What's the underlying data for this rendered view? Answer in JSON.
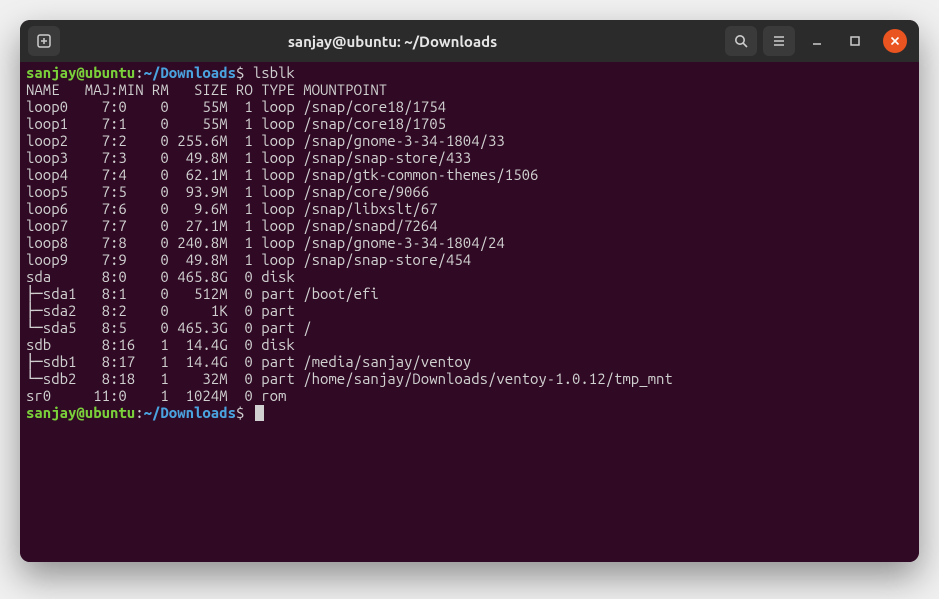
{
  "window": {
    "title": "sanjay@ubuntu: ~/Downloads"
  },
  "prompt": {
    "user_host": "sanjay@ubuntu",
    "path": "~/Downloads",
    "command": "lsblk"
  },
  "lsblk": {
    "header": "NAME   MAJ:MIN RM   SIZE RO TYPE MOUNTPOINT",
    "rows": [
      "loop0    7:0    0    55M  1 loop /snap/core18/1754",
      "loop1    7:1    0    55M  1 loop /snap/core18/1705",
      "loop2    7:2    0 255.6M  1 loop /snap/gnome-3-34-1804/33",
      "loop3    7:3    0  49.8M  1 loop /snap/snap-store/433",
      "loop4    7:4    0  62.1M  1 loop /snap/gtk-common-themes/1506",
      "loop5    7:5    0  93.9M  1 loop /snap/core/9066",
      "loop6    7:6    0   9.6M  1 loop /snap/libxslt/67",
      "loop7    7:7    0  27.1M  1 loop /snap/snapd/7264",
      "loop8    7:8    0 240.8M  1 loop /snap/gnome-3-34-1804/24",
      "loop9    7:9    0  49.8M  1 loop /snap/snap-store/454",
      "sda      8:0    0 465.8G  0 disk ",
      "├─sda1   8:1    0   512M  0 part /boot/efi",
      "├─sda2   8:2    0     1K  0 part ",
      "└─sda5   8:5    0 465.3G  0 part /",
      "sdb      8:16   1  14.4G  0 disk ",
      "├─sdb1   8:17   1  14.4G  0 part /media/sanjay/ventoy",
      "└─sdb2   8:18   1    32M  0 part /home/sanjay/Downloads/ventoy-1.0.12/tmp_mnt",
      "sr0     11:0    1  1024M  0 rom  "
    ]
  }
}
